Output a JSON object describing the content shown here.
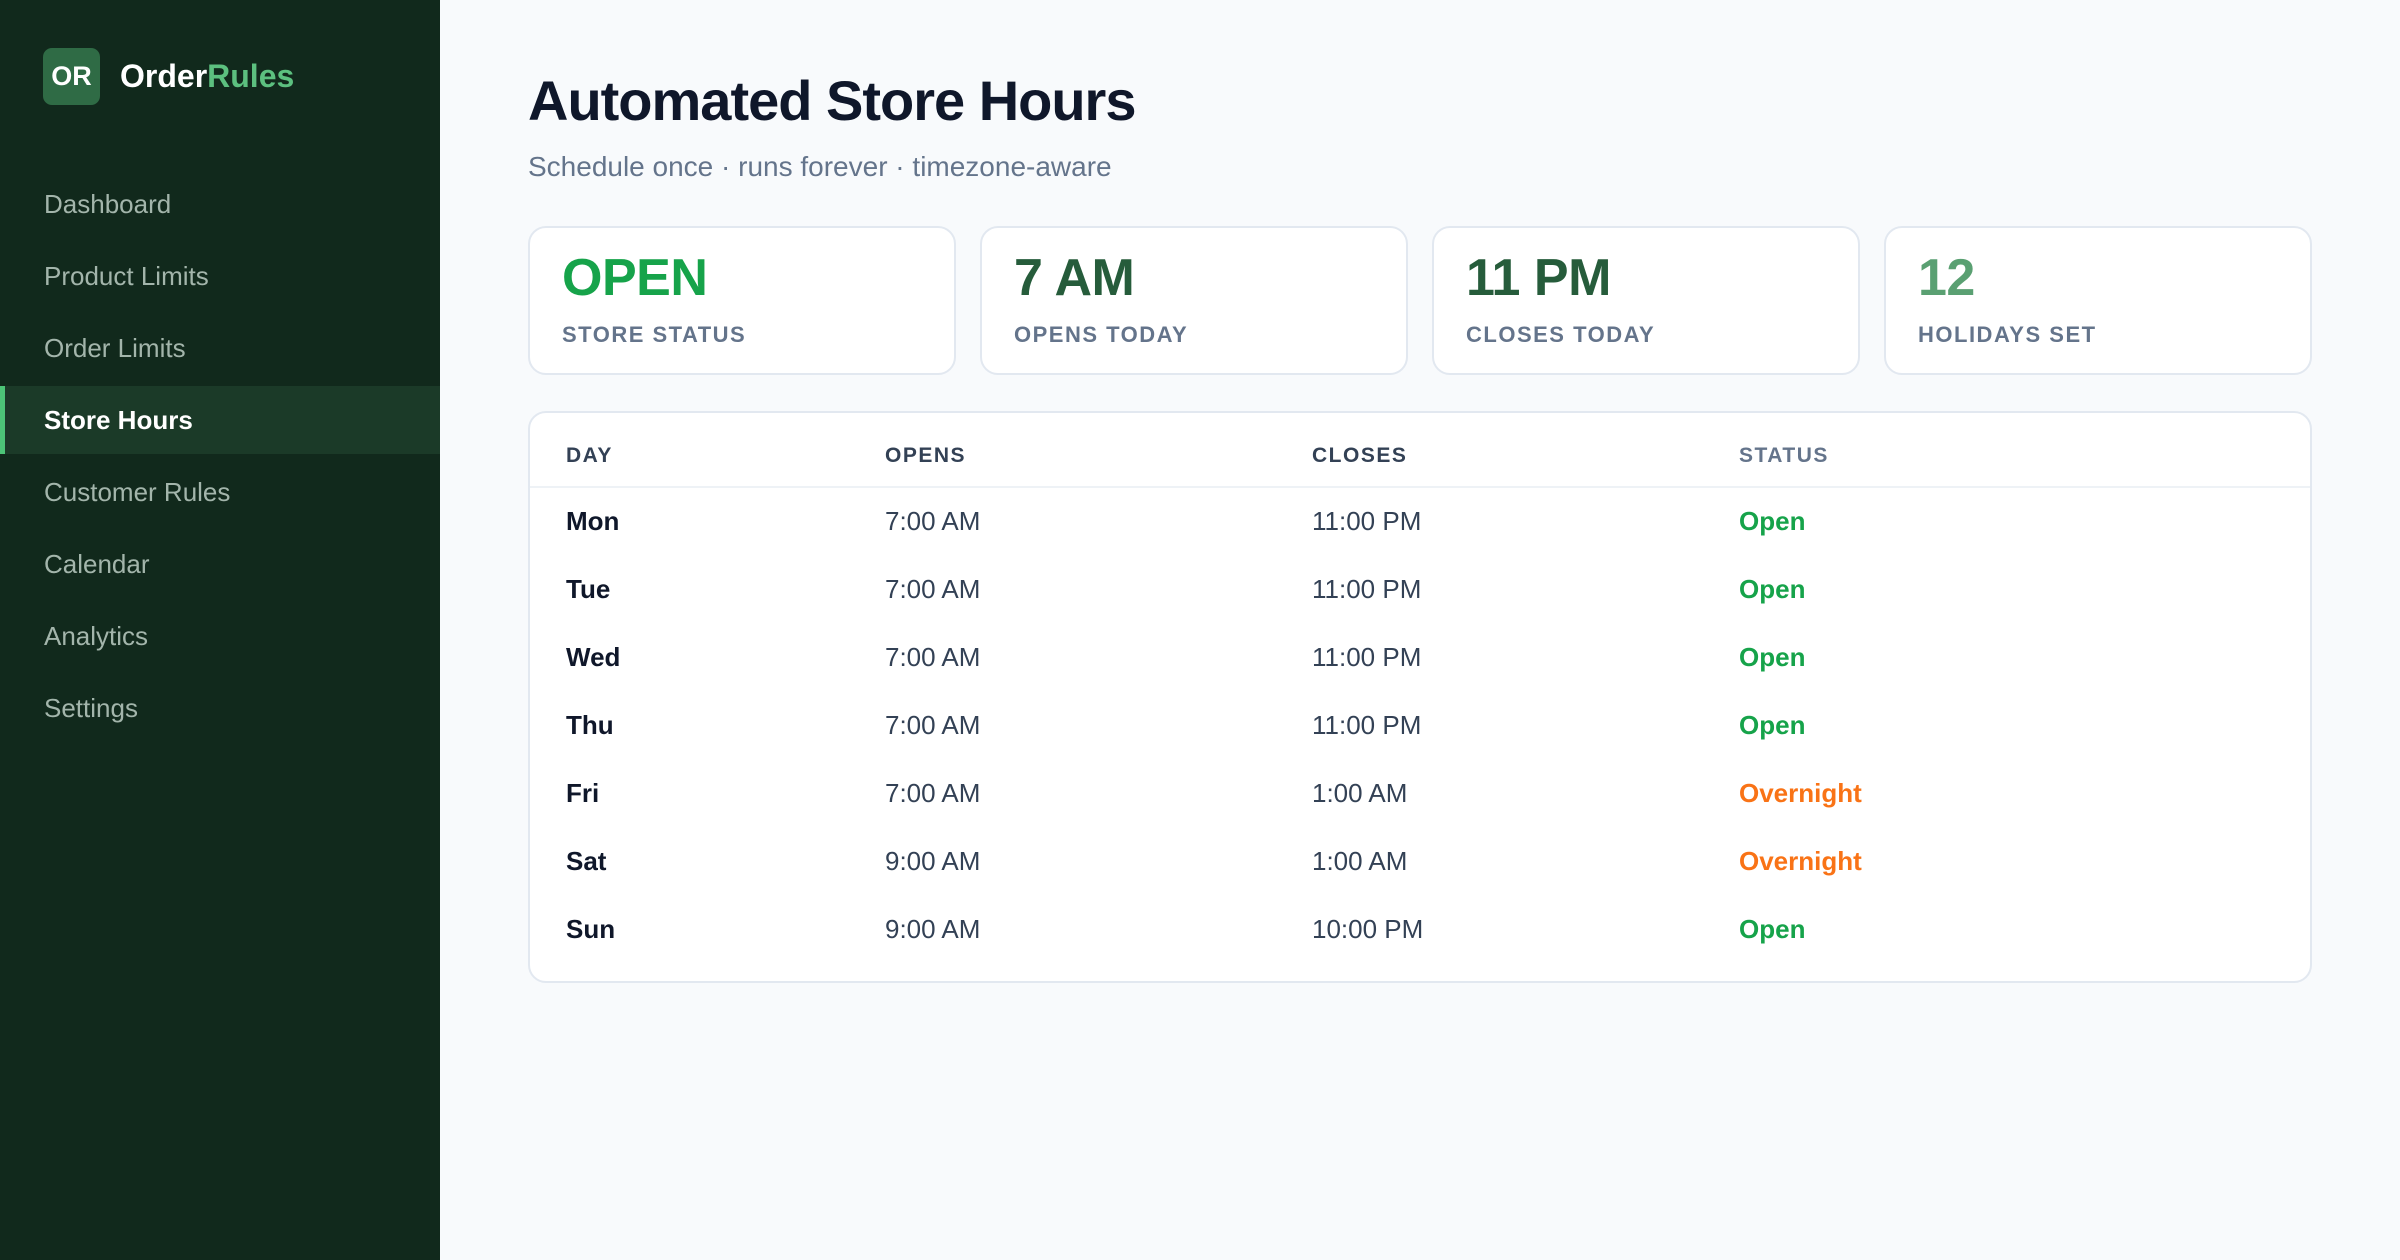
{
  "brand": {
    "logo_text": "OR",
    "name_primary": "Order",
    "name_accent": "Rules",
    "accent_color": "#5cc07f"
  },
  "nav": {
    "items": [
      {
        "label": "Dashboard",
        "active": false
      },
      {
        "label": "Product Limits",
        "active": false
      },
      {
        "label": "Order Limits",
        "active": false
      },
      {
        "label": "Store Hours",
        "active": true
      },
      {
        "label": "Customer Rules",
        "active": false
      },
      {
        "label": "Calendar",
        "active": false
      },
      {
        "label": "Analytics",
        "active": false
      },
      {
        "label": "Settings",
        "active": false
      }
    ]
  },
  "header": {
    "title": "Automated Store Hours",
    "subtitle": "Schedule once · runs forever · timezone-aware"
  },
  "stats": [
    {
      "value": "OPEN",
      "label": "STORE STATUS",
      "color": "#16a34a"
    },
    {
      "value": "7 AM",
      "label": "OPENS TODAY",
      "color": "#265c3b"
    },
    {
      "value": "11 PM",
      "label": "CLOSES TODAY",
      "color": "#265c3b"
    },
    {
      "value": "12",
      "label": "HOLIDAYS SET",
      "color": "#5aa072"
    }
  ],
  "table": {
    "headers": {
      "day": "DAY",
      "opens": "OPENS",
      "closes": "CLOSES",
      "status": "STATUS"
    },
    "rows": [
      {
        "day": "Mon",
        "opens": "7:00 AM",
        "closes": "11:00 PM",
        "status": "Open"
      },
      {
        "day": "Tue",
        "opens": "7:00 AM",
        "closes": "11:00 PM",
        "status": "Open"
      },
      {
        "day": "Wed",
        "opens": "7:00 AM",
        "closes": "11:00 PM",
        "status": "Open"
      },
      {
        "day": "Thu",
        "opens": "7:00 AM",
        "closes": "11:00 PM",
        "status": "Open"
      },
      {
        "day": "Fri",
        "opens": "7:00 AM",
        "closes": "1:00 AM",
        "status": "Overnight"
      },
      {
        "day": "Sat",
        "opens": "9:00 AM",
        "closes": "1:00 AM",
        "status": "Overnight"
      },
      {
        "day": "Sun",
        "opens": "9:00 AM",
        "closes": "10:00 PM",
        "status": "Open"
      }
    ],
    "status_colors": {
      "Open": "#16a34a",
      "Overnight": "#f97316"
    }
  }
}
